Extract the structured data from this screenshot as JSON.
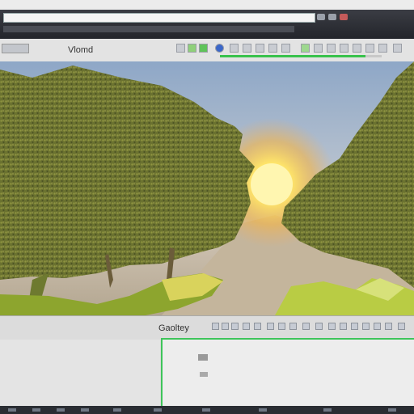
{
  "window": {
    "address_text": "",
    "title_text": ""
  },
  "toolbar": {
    "mode_label": "Vlomd",
    "render_progress": 0.9,
    "tools": [
      "cursor-tool",
      "move-tool",
      "rotate-tool",
      "scale-tool",
      "snap-tool",
      "light-tool",
      "camera-tool",
      "grid-tool",
      "render-tool",
      "settings-tool"
    ]
  },
  "viewport": {
    "scene": "forest-sunset",
    "sun_color": "#fff6b0",
    "foliage_color": "#6d7330"
  },
  "panel": {
    "left_label": "",
    "title": "Gaoltey",
    "accent": "#3ec45a"
  }
}
